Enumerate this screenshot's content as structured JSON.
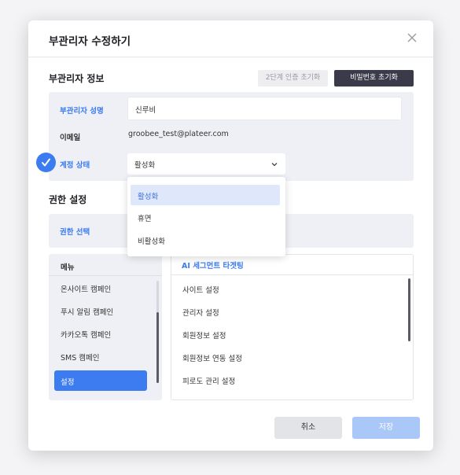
{
  "modal": {
    "title": "부관리자 수정하기"
  },
  "admin_info": {
    "section_title": "부관리자 정보",
    "reset_2fa_label": "2단계 인증 초기화",
    "reset_password_label": "비밀번호 초기화",
    "name_label": "부관리자 성명",
    "name_value": "신루비",
    "email_label": "이메일",
    "email_value": "groobee_test@plateer.com",
    "status_label": "계정 상태",
    "status_value": "활성화"
  },
  "status_dropdown": {
    "options": [
      "활성화",
      "휴면",
      "비활성화"
    ],
    "selected_index": 0
  },
  "permissions": {
    "section_title": "권한 설정",
    "select_label": "권한 선택"
  },
  "menu_panel": {
    "header": "메뉴",
    "items": [
      "온사이트 캠페인",
      "푸시 알림 캠페인",
      "카카오톡 캠페인",
      "SMS 캠페인",
      "설정"
    ],
    "active_index": 4
  },
  "sub_panel": {
    "header": "AI 세그먼트 타겟팅",
    "items": [
      "사이트 설정",
      "관리자 설정",
      "회원정보 설정",
      "회원정보 연동 설정",
      "피로도 관리 설정"
    ]
  },
  "footer": {
    "cancel_label": "취소",
    "save_label": "저장"
  },
  "colors": {
    "accent": "#3c7cf0",
    "dark_button": "#3a3a4a",
    "save_disabled": "#a9c7f7"
  }
}
